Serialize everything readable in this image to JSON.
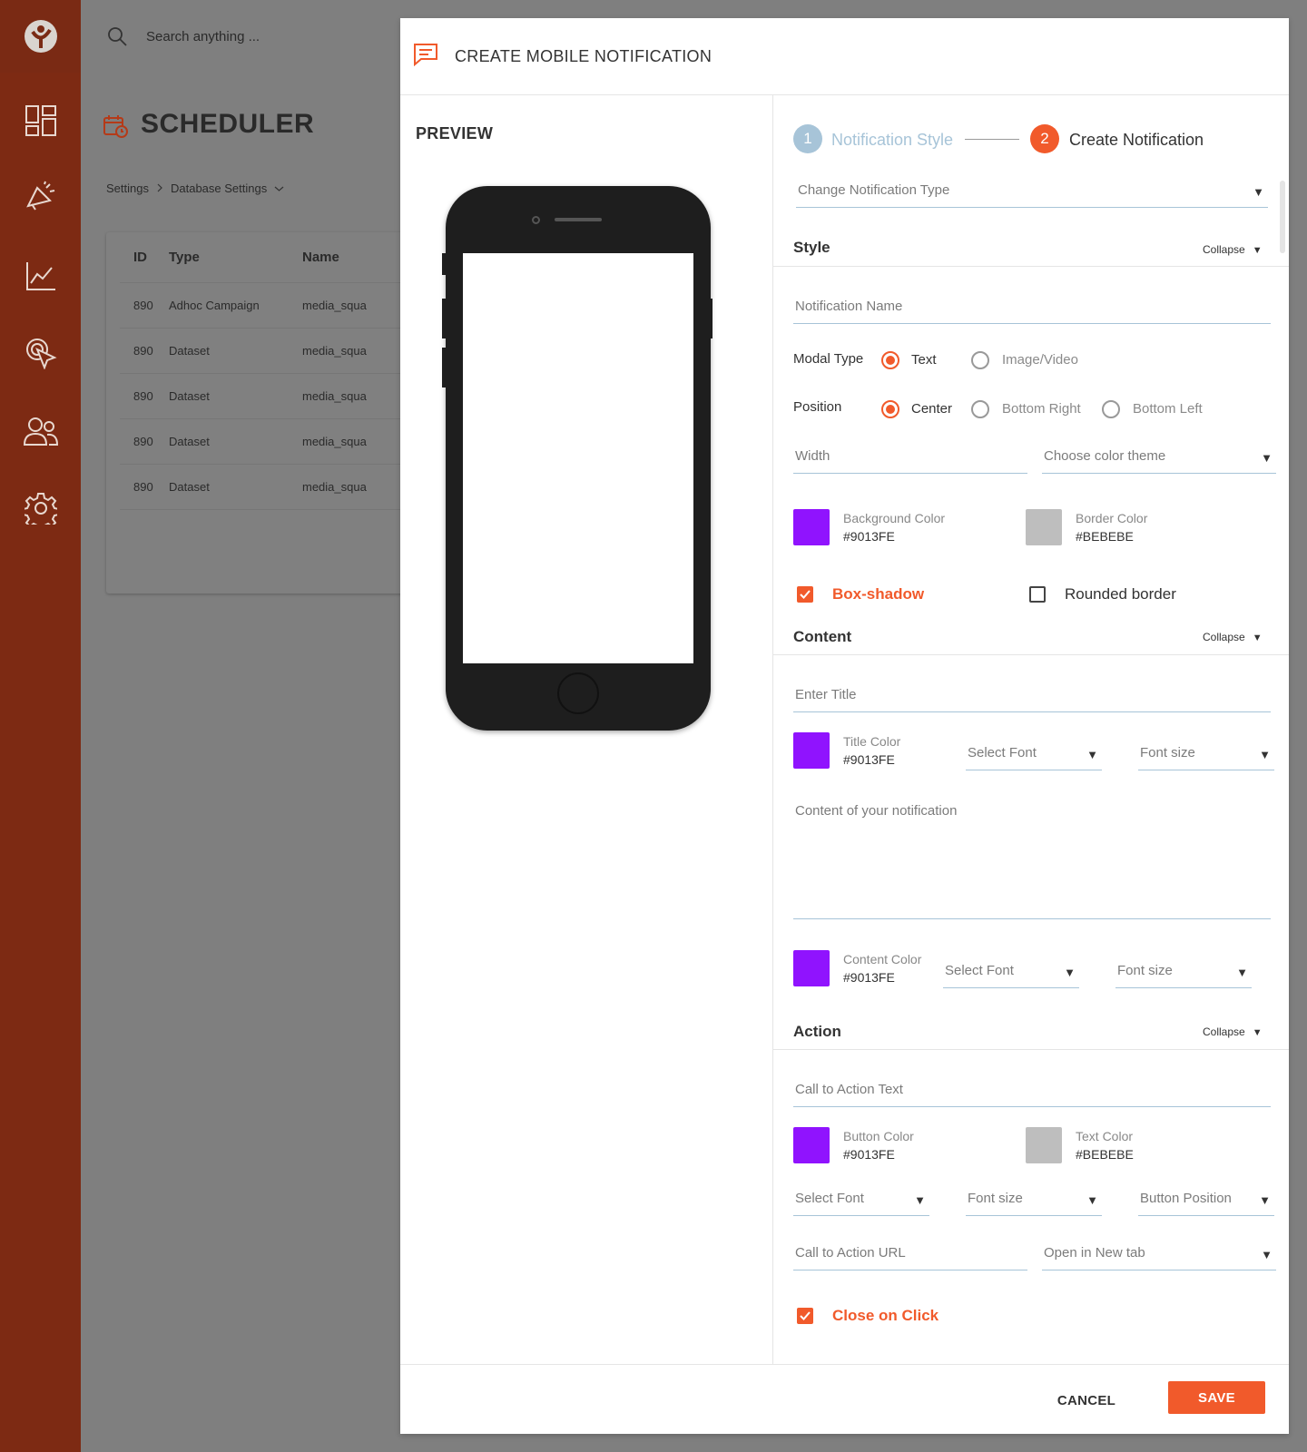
{
  "colors": {
    "sidebar_bg": "#7d2a13",
    "accent": "#f15a2b",
    "step_inactive": "#a7c4d8",
    "overlay_bg": "#7f7f7f",
    "purple_swatch": "#9013FE",
    "grey_swatch": "#BEBEBE"
  },
  "sidebar": {
    "logo_icon": "brand-logo-icon",
    "items": [
      {
        "icon": "dashboard-icon"
      },
      {
        "icon": "campaign-megaphone-icon"
      },
      {
        "icon": "analytics-chart-icon"
      },
      {
        "icon": "pointer-click-icon"
      },
      {
        "icon": "users-icon"
      },
      {
        "icon": "settings-gear-icon"
      }
    ]
  },
  "topbar": {
    "search_placeholder": "Search anything ..."
  },
  "page": {
    "title": "SCHEDULER",
    "breadcrumb": [
      "Settings",
      "Database Settings"
    ]
  },
  "table": {
    "columns": [
      "ID",
      "Type",
      "Name"
    ],
    "rows": [
      {
        "id": "890",
        "type": "Adhoc Campaign",
        "name": "media_squa"
      },
      {
        "id": "890",
        "type": "Dataset",
        "name": "media_squa"
      },
      {
        "id": "890",
        "type": "Dataset",
        "name": "media_squa"
      },
      {
        "id": "890",
        "type": "Dataset",
        "name": "media_squa"
      },
      {
        "id": "890",
        "type": "Dataset",
        "name": "media_squa"
      }
    ]
  },
  "modal": {
    "title": "CREATE MOBILE NOTIFICATION",
    "preview_label": "PREVIEW",
    "steps": [
      {
        "number": "1",
        "label": "Notification Style"
      },
      {
        "number": "2",
        "label": "Create Notification"
      }
    ],
    "change_type_placeholder": "Change Notification Type",
    "collapse_label": "Collapse",
    "style": {
      "title": "Style",
      "notification_name_placeholder": "Notification Name",
      "modal_type_label": "Modal Type",
      "modal_type_options": [
        "Text",
        "Image/Video"
      ],
      "modal_type_selected": "Text",
      "position_label": "Position",
      "position_options": [
        "Center",
        "Bottom Right",
        "Bottom Left"
      ],
      "position_selected": "Center",
      "width_placeholder": "Width",
      "color_theme_placeholder": "Choose color theme",
      "background_color_label": "Background Color",
      "background_color_value": "#9013FE",
      "border_color_label": "Border Color",
      "border_color_value": "#BEBEBE",
      "box_shadow_label": "Box-shadow",
      "box_shadow_checked": true,
      "rounded_border_label": "Rounded border",
      "rounded_border_checked": false
    },
    "content": {
      "title": "Content",
      "enter_title_placeholder": "Enter Title",
      "title_color_label": "Title Color",
      "title_color_value": "#9013FE",
      "select_font_placeholder": "Select Font",
      "font_size_placeholder": "Font size",
      "body_placeholder": "Content of your notification",
      "content_color_label": "Content Color",
      "content_color_value": "#9013FE"
    },
    "action": {
      "title": "Action",
      "cta_text_placeholder": "Call to Action Text",
      "button_color_label": "Button Color",
      "button_color_value": "#9013FE",
      "text_color_label": "Text Color",
      "text_color_value": "#BEBEBE",
      "select_font_placeholder": "Select Font",
      "font_size_placeholder": "Font size",
      "button_position_placeholder": "Button Position",
      "cta_url_placeholder": "Call to Action URL",
      "open_target_value": "Open in New tab",
      "close_on_click_label": "Close on Click",
      "close_on_click_checked": true
    },
    "footer": {
      "cancel_label": "CANCEL",
      "save_label": "SAVE"
    }
  }
}
